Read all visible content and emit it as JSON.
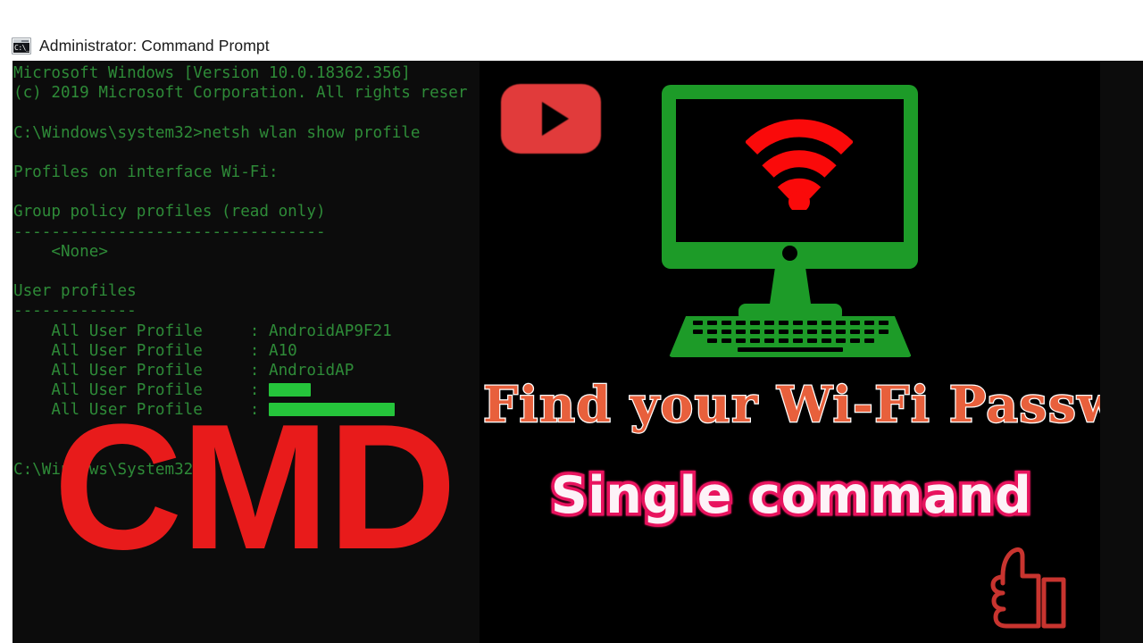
{
  "window": {
    "title": "Administrator: Command Prompt",
    "icon": "cmd-icon",
    "icon_glyph": "C:\\_"
  },
  "console": {
    "background_color": "#0c0c0c",
    "text_color": "#2e8b38",
    "lines": [
      "Microsoft Windows [Version 10.0.18362.356]",
      "(c) 2019 Microsoft Corporation. All rights reser",
      "",
      "C:\\Windows\\system32>netsh wlan show profile",
      "",
      "Profiles on interface Wi-Fi:",
      "",
      "Group policy profiles (read only)",
      "---------------------------------",
      "    <None>",
      "",
      "User profiles",
      "-------------"
    ],
    "profiles_label": "    All User Profile     : ",
    "profiles": [
      {
        "name": "AndroidAP9F21",
        "redacted": false
      },
      {
        "name": "A10",
        "redacted": false
      },
      {
        "name": "AndroidAP",
        "redacted": false
      },
      {
        "name": "",
        "redacted": true
      },
      {
        "name": "",
        "redacted": true
      }
    ],
    "prompt_line": "C:\\Windows\\System32>",
    "redaction_color": "#25c43b"
  },
  "overlay": {
    "cmd_watermark": "CMD",
    "cmd_watermark_color": "#e81b1b"
  },
  "artwork": {
    "background_color": "#000000",
    "youtube_icon": "youtube-play-icon",
    "youtube_color": "#e13b3b",
    "monitor_color": "#1d9b28",
    "wifi_icon": "wifi-signal-icon",
    "wifi_color": "#fa0a0a",
    "headline": "Find your Wi-Fi Password",
    "headline_color": "#e8603c",
    "headline_outline_color": "#ffffff",
    "subline": "Single command",
    "subline_color": "#fdf2f7",
    "subline_outline_color": "#e8135e",
    "thumbs_up_icon": "thumbs-up-icon",
    "thumbs_up_color": "#c8342f"
  }
}
